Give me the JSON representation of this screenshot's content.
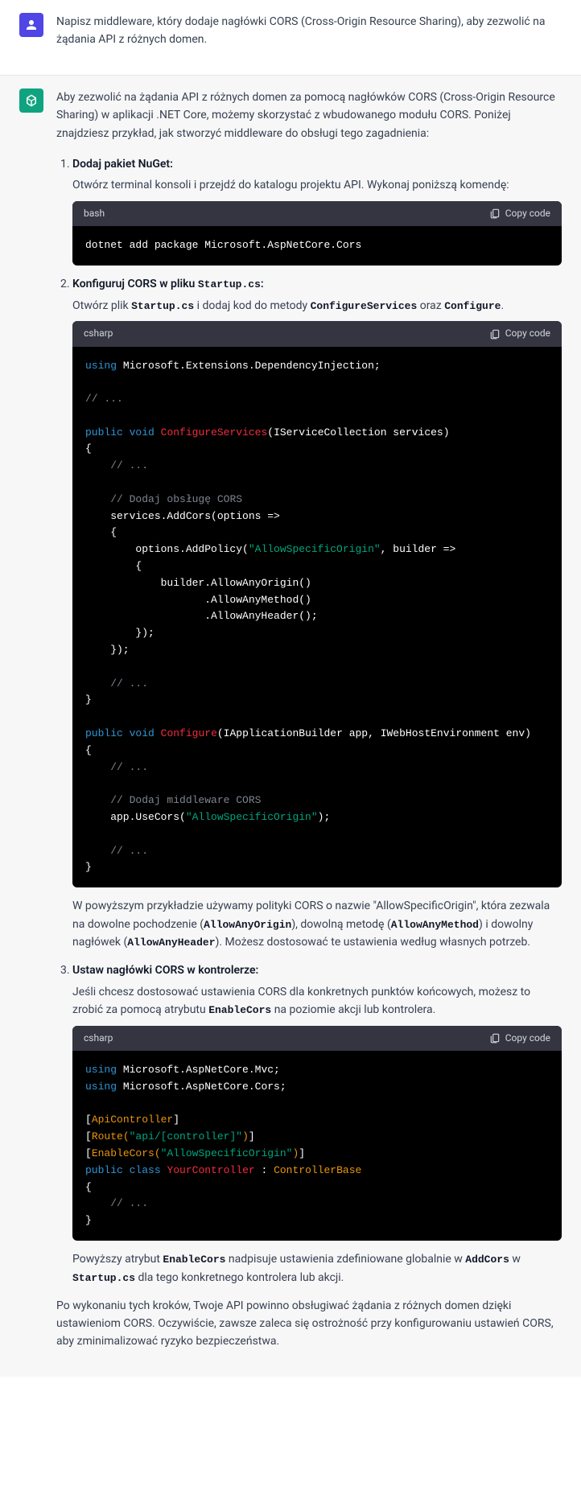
{
  "user": {
    "text": "Napisz middleware, który dodaje nagłówki CORS (Cross-Origin Resource Sharing), aby zezwolić na żądania API z różnych domen."
  },
  "assistant": {
    "intro": "Aby zezwolić na żądania API z różnych domen za pomocą nagłówków CORS (Cross-Origin Resource Sharing) w aplikacji .NET Core, możemy skorzystać z wbudowanego modułu CORS. Poniżej znajdziesz przykład, jak stworzyć middleware do obsługi tego zagadnienia:",
    "copy_label": "Copy code",
    "step1": {
      "title": "Dodaj pakiet NuGet:",
      "desc": "Otwórz terminal konsoli i przejdź do katalogu projektu API. Wykonaj poniższą komendę:",
      "lang": "bash",
      "code": "dotnet add package Microsoft.AspNetCore.Cors"
    },
    "step2": {
      "title_pre": "Konfiguruj CORS w pliku ",
      "title_code": "Startup.cs",
      "title_post": ":",
      "desc_pre": "Otwórz plik ",
      "desc_c1": "Startup.cs",
      "desc_mid": " i dodaj kod do metody ",
      "desc_c2": "ConfigureServices",
      "desc_mid2": " oraz ",
      "desc_c3": "Configure",
      "desc_post": ".",
      "lang": "csharp",
      "after_p1_a": "W powyższym przykładzie używamy polityki CORS o nazwie \"AllowSpecificOrigin\", która zezwala na dowolne pochodzenie (",
      "after_p1_c1": "AllowAnyOrigin",
      "after_p1_b": "), dowolną metodę (",
      "after_p1_c2": "AllowAnyMethod",
      "after_p1_c": ") i dowolny nagłówek (",
      "after_p1_c3": "AllowAnyHeader",
      "after_p1_d": "). Możesz dostosować te ustawienia według własnych potrzeb."
    },
    "step3": {
      "title": "Ustaw nagłówki CORS w kontrolerze:",
      "desc_a": "Jeśli chcesz dostosować ustawienia CORS dla konkretnych punktów końcowych, możesz to zrobić za pomocą atrybutu ",
      "desc_c1": "EnableCors",
      "desc_b": " na poziomie akcji lub kontrolera.",
      "lang": "csharp",
      "after_a": "Powyższy atrybut ",
      "after_c1": "EnableCors",
      "after_b": " nadpisuje ustawienia zdefiniowane globalnie w ",
      "after_c2": "AddCors",
      "after_c": " w ",
      "after_c3": "Startup.cs",
      "after_d": " dla tego konkretnego kontrolera lub akcji."
    },
    "outro": "Po wykonaniu tych kroków, Twoje API powinno obsługiwać żądania z różnych domen dzięki ustawieniom CORS. Oczywiście, zawsze zaleca się ostrożność przy konfigurowaniu ustawień CORS, aby zminimalizować ryzyko bezpieczeństwa."
  },
  "code2_tokens": {
    "using": "using",
    "ns1": " Microsoft.Extensions.DependencyInjection;",
    "com_dots": "// ...",
    "public": "public",
    "void": "void",
    "cfgServices": "ConfigureServices",
    "cfgServicesParams": "(IServiceCollection services)",
    "com_cors1": "// Dodaj obsługę CORS",
    "addCors": "    services.AddCors(options =>",
    "open": "    {",
    "addPolicy_a": "        options.AddPolicy(",
    "addPolicy_str": "\"AllowSpecificOrigin\"",
    "addPolicy_b": ", builder =>",
    "open2": "        {",
    "b1": "            builder.AllowAnyOrigin()",
    "b2": "                   .AllowAnyMethod()",
    "b3": "                   .AllowAnyHeader();",
    "close2": "        });",
    "close1": "    });",
    "configure": "Configure",
    "configureParams": "(IApplicationBuilder app, IWebHostEnvironment env)",
    "com_cors2": "// Dodaj middleware CORS",
    "useCors_a": "    app.UseCors(",
    "useCors_str": "\"AllowSpecificOrigin\"",
    "useCors_b": ");"
  },
  "code3_tokens": {
    "using": "using",
    "ns1": " Microsoft.AspNetCore.Mvc;",
    "ns2": " Microsoft.AspNetCore.Cors;",
    "attr_api": "ApiController",
    "route_a": "Route(",
    "route_str": "\"api/[controller]\"",
    "route_b": ")",
    "ec_a": "EnableCors(",
    "ec_str": "\"AllowSpecificOrigin\"",
    "ec_b": ")",
    "public": "public",
    "class": "class",
    "yc": "YourController",
    "cb": "ControllerBase",
    "com_dots": "// ..."
  }
}
